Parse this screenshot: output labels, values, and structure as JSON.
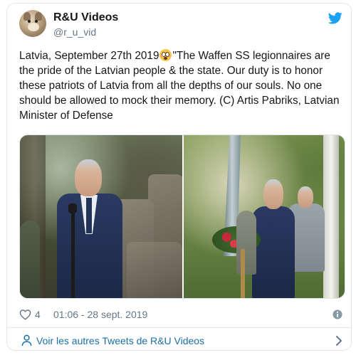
{
  "tweet": {
    "author_name": "R&U Videos",
    "author_handle": "@r_u_vid",
    "text_before_emoji": "Latvia, September 27th 2019",
    "emoji": "flushed-face-emoji",
    "text_after_emoji": "\"The Waffen SS legionnaires are the pride of the Latvian people & the state. Our duty is to honor these patriots of Latvia from all the depths of our souls. No one should be allowed to mock their memory. (C) Artis Pabriks, Latvian Minister of Defense",
    "likes": "4",
    "timestamp": "01:06 - 28 sept. 2019"
  },
  "footer": {
    "more_tweets_label": "Voir les autres Tweets de R&U Videos"
  },
  "icons": {
    "platform": "twitter-bird-icon",
    "like": "heart-icon",
    "info": "info-icon",
    "profile": "user-icon",
    "next": "chevron-right-icon"
  },
  "colors": {
    "brand": "#1da1f2",
    "link": "#1b6fa8",
    "muted_text": "#657786",
    "border": "#e1e8ed"
  }
}
